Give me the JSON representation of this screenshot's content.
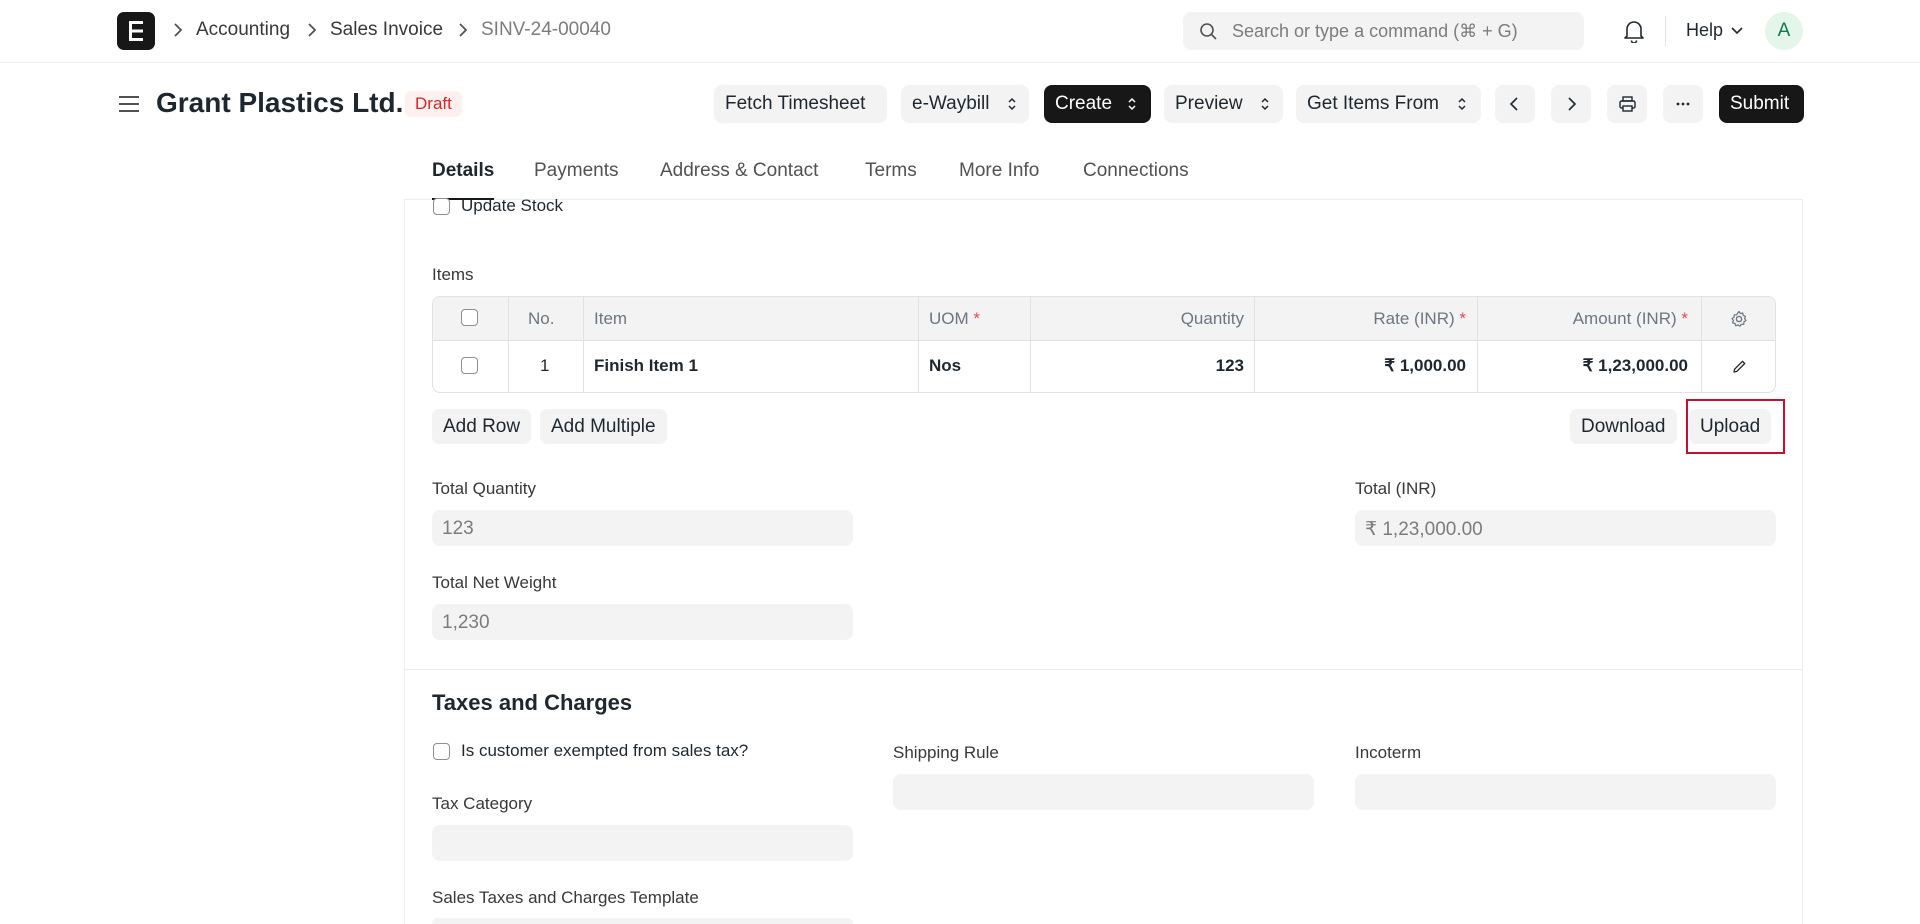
{
  "breadcrumbs": [
    "Accounting",
    "Sales Invoice",
    "SINV-24-00040"
  ],
  "search": {
    "placeholder": "Search or type a command (⌘ + G)"
  },
  "navbar": {
    "help_label": "Help",
    "avatar_initial": "A"
  },
  "page": {
    "title": "Grant Plastics Ltd.",
    "status": "Draft"
  },
  "toolbar": {
    "fetch_timesheet": "Fetch Timesheet",
    "e_waybill": "e-Waybill",
    "create": "Create",
    "preview": "Preview",
    "get_items_from": "Get Items From",
    "submit": "Submit"
  },
  "tabs": [
    "Details",
    "Payments",
    "Address & Contact",
    "Terms",
    "More Info",
    "Connections"
  ],
  "update_stock_label": "Update Stock",
  "items": {
    "section_label": "Items",
    "columns": {
      "no": "No.",
      "item": "Item",
      "uom": "UOM",
      "quantity": "Quantity",
      "rate": "Rate (INR)",
      "amount": "Amount (INR)",
      "required_mark": "*"
    },
    "rows": [
      {
        "no": "1",
        "item": "Finish Item 1",
        "uom": "Nos",
        "quantity": "123",
        "rate": "₹ 1,000.00",
        "amount": "₹ 1,23,000.00"
      }
    ],
    "add_row": "Add Row",
    "add_multiple": "Add Multiple",
    "download": "Download",
    "upload": "Upload"
  },
  "totals": {
    "total_quantity_label": "Total Quantity",
    "total_quantity": "123",
    "total_label": "Total (INR)",
    "total": "₹ 1,23,000.00",
    "total_net_weight_label": "Total Net Weight",
    "total_net_weight": "1,230"
  },
  "taxes": {
    "title": "Taxes and Charges",
    "exempt_label": "Is customer exempted from sales tax?",
    "shipping_rule_label": "Shipping Rule",
    "incoterm_label": "Incoterm",
    "tax_category_label": "Tax Category",
    "template_label": "Sales Taxes and Charges Template"
  },
  "colors": {
    "accent_dark": "#171717",
    "draft_badge_bg": "#fff0f0",
    "draft_badge_text": "#cc2929",
    "highlight_border": "#c8102e"
  }
}
